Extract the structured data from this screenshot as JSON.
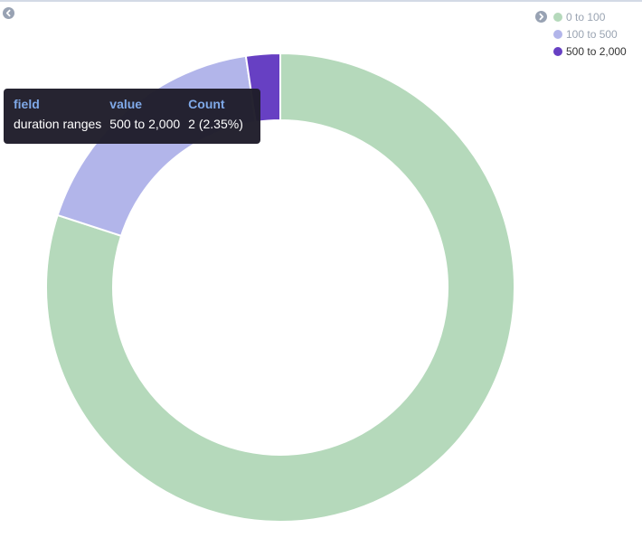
{
  "chart_data": {
    "type": "pie",
    "donut": true,
    "title": "",
    "categories": [
      "0 to 100",
      "100 to 500",
      "500 to 2,000"
    ],
    "values": [
      68,
      15,
      2
    ],
    "colors": [
      "#b5d9bb",
      "#b2b5ea",
      "#6740c3"
    ],
    "legend_position": "top-right"
  },
  "legend": {
    "items": [
      {
        "label": "0 to 100",
        "color": "#b5d9bb",
        "text_color": "#9aa4b2"
      },
      {
        "label": "100 to 500",
        "color": "#b2b5ea",
        "text_color": "#9aa4b2"
      },
      {
        "label": "500 to 2,000",
        "color": "#6740c3",
        "text_color": "#333333"
      }
    ]
  },
  "tooltip": {
    "headers": {
      "field": "field",
      "value": "value",
      "count": "Count"
    },
    "row": {
      "field": "duration ranges",
      "value": "500 to 2,000",
      "count": "2 (2.35%)"
    }
  },
  "nav": {
    "prev_icon": "chevron-left-icon",
    "next_icon": "chevron-right-icon"
  }
}
